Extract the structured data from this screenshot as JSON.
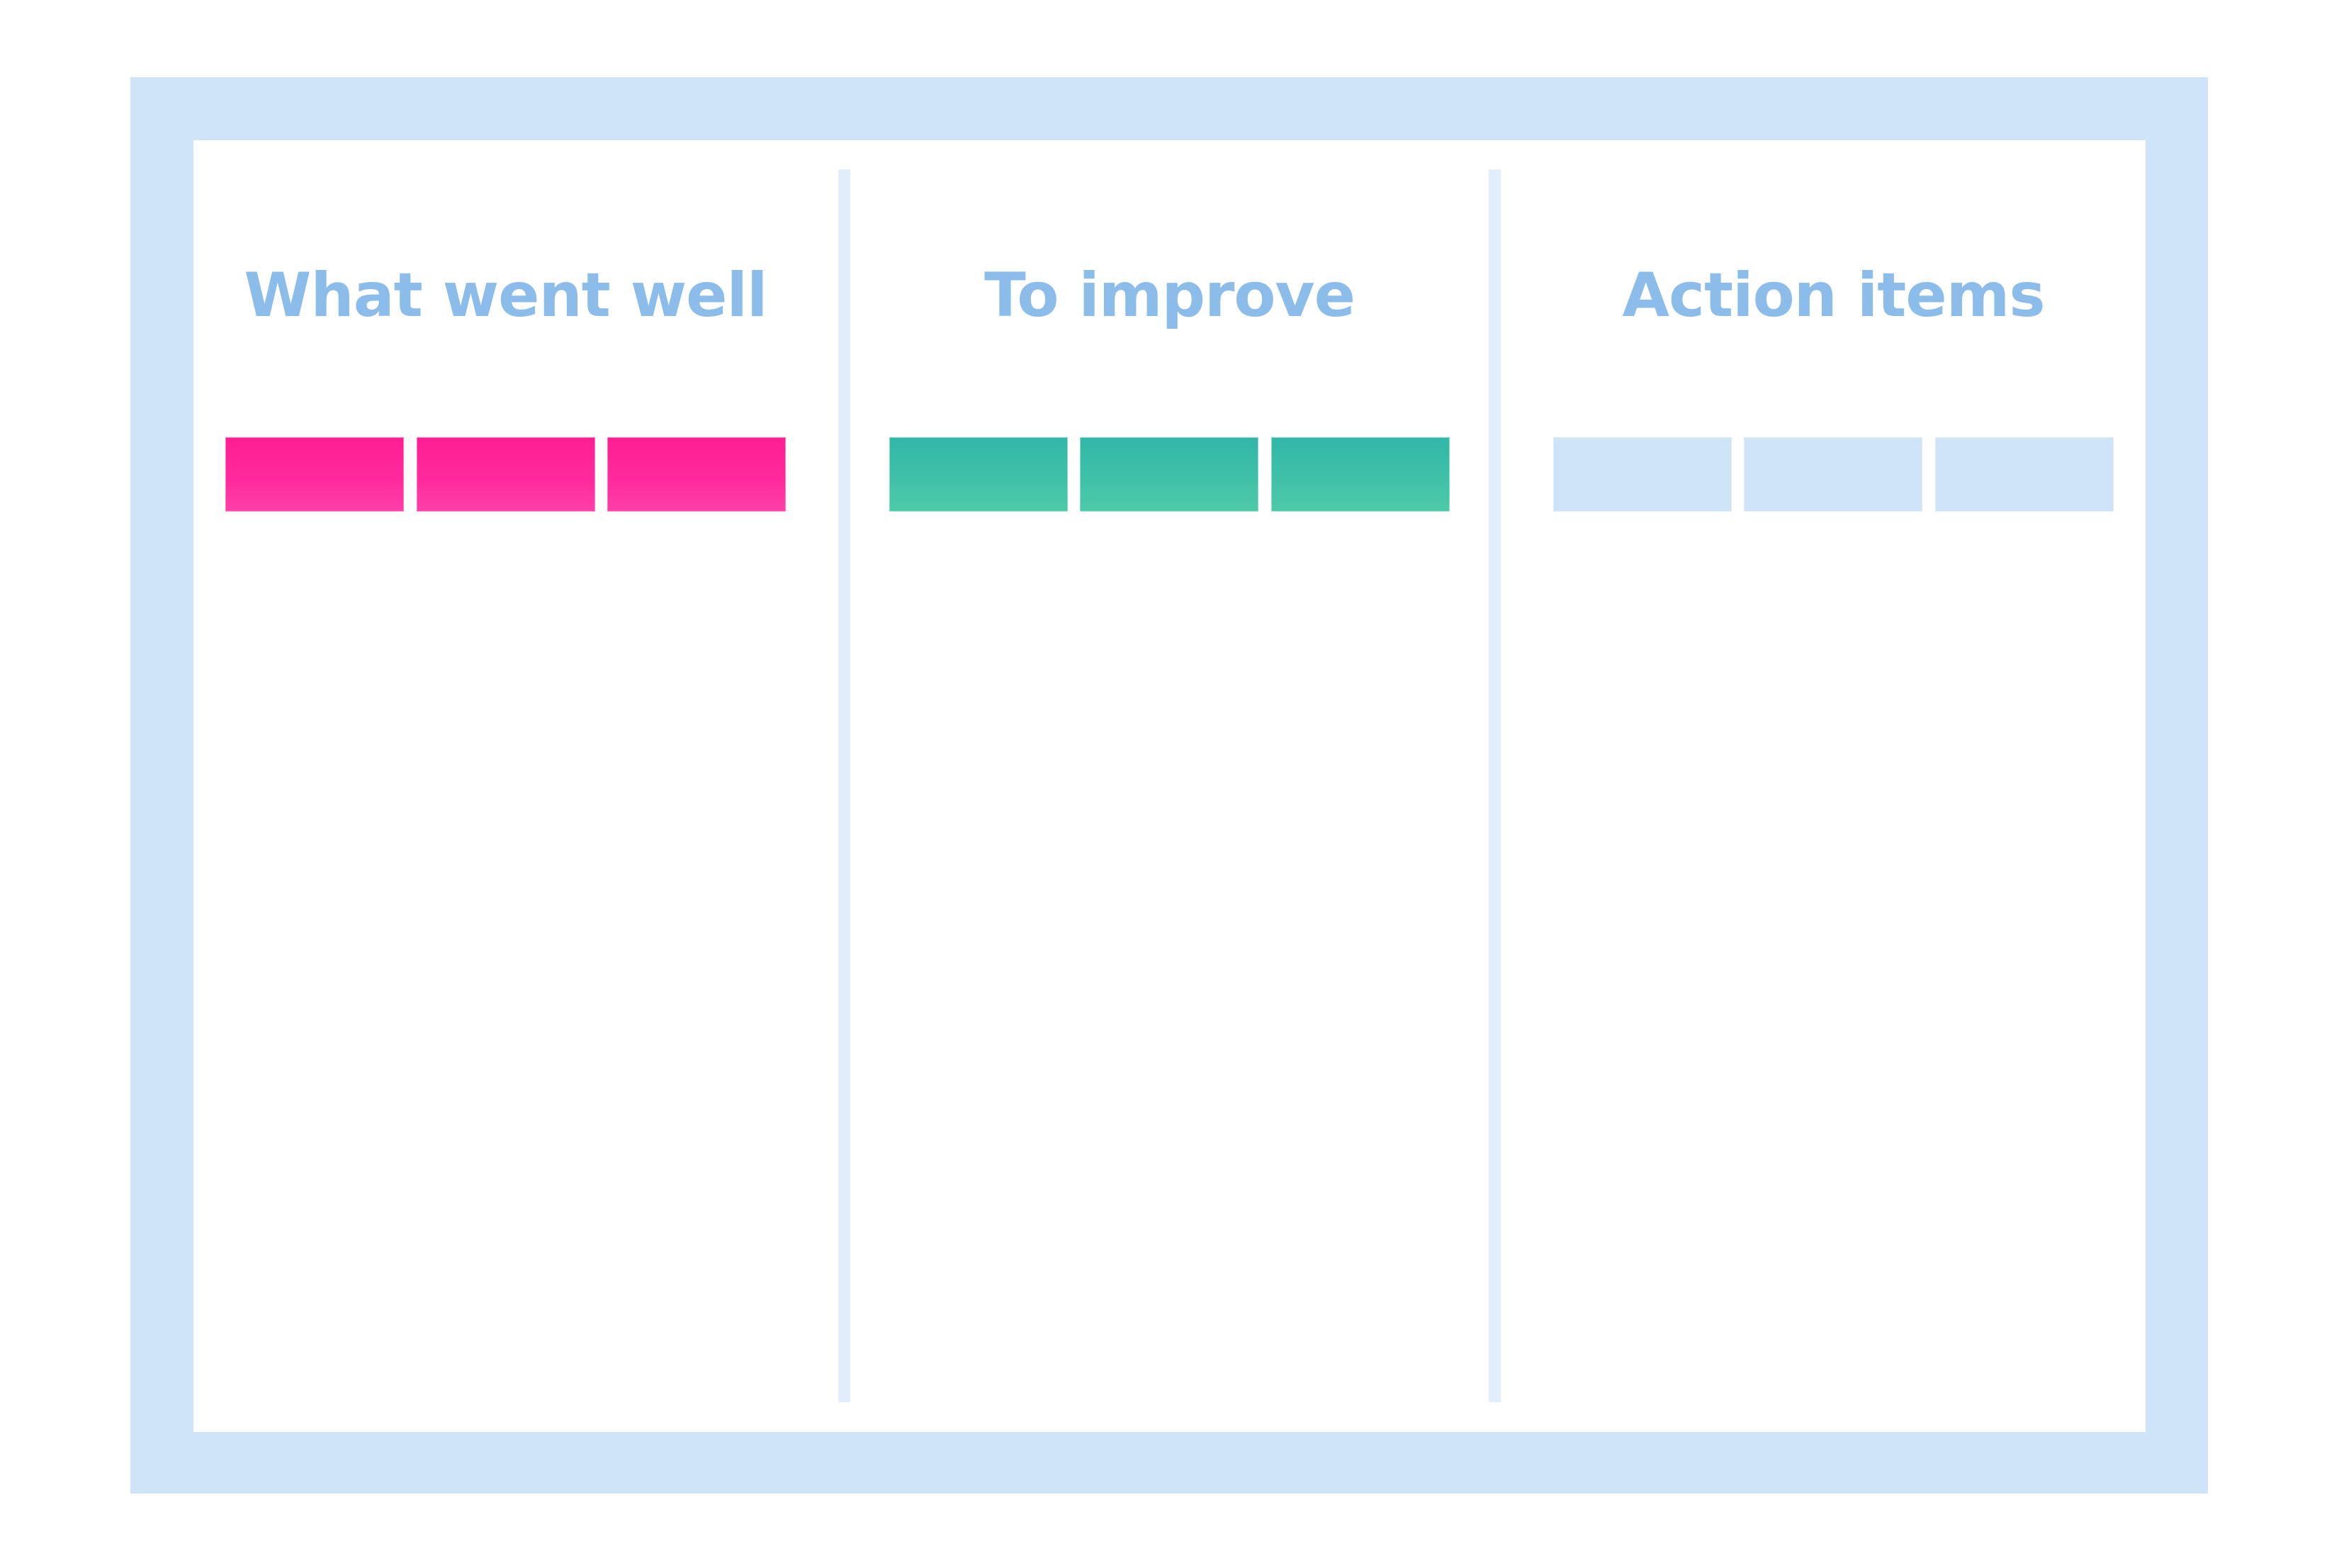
{
  "board": {
    "type": "retrospective-board",
    "columns": [
      {
        "title": "What went well",
        "card_color": "#FF2B9E",
        "cards": [
          {},
          {},
          {}
        ]
      },
      {
        "title": "To improve",
        "card_color": "#3FBFA8",
        "cards": [
          {},
          {},
          {}
        ]
      },
      {
        "title": "Action items",
        "card_color": "#D0E4F7",
        "cards": [
          {},
          {},
          {}
        ]
      }
    ]
  },
  "colors": {
    "frame": "#D0E4F7",
    "divider": "#E3EEFC",
    "heading_text": "#8BBCEA",
    "background": "#FFFFFF"
  }
}
